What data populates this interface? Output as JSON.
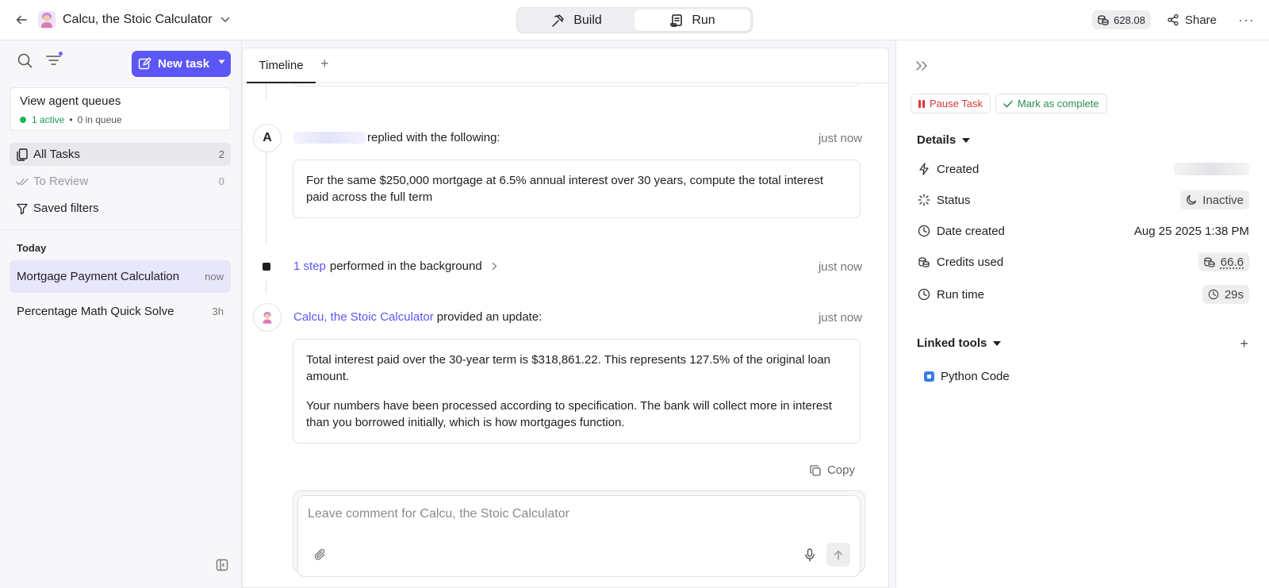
{
  "header": {
    "agent_name": "Calcu, the Stoic Calculator",
    "modes": [
      {
        "label": "Build",
        "icon": "hammer-icon",
        "active": false
      },
      {
        "label": "Run",
        "icon": "scroll-icon",
        "active": true
      }
    ],
    "credits": "628.08",
    "share_label": "Share",
    "more_label": "···"
  },
  "sidebar": {
    "new_task_label": "New task",
    "queues": {
      "title": "View agent queues",
      "active": "1 active",
      "in_queue": "0 in queue"
    },
    "nav": [
      {
        "label": "All Tasks",
        "count": "2",
        "icon": "copy-icon",
        "active": true
      },
      {
        "label": "To Review",
        "count": "0",
        "icon": "double-check-icon",
        "active": false
      },
      {
        "label": "Saved filters",
        "count": "",
        "icon": "filter-icon",
        "active": false
      }
    ],
    "section_label": "Today",
    "tasks": [
      {
        "name": "Mortgage Payment Calculation",
        "time": "now",
        "active": true
      },
      {
        "name": "Percentage Math Quick Solve",
        "time": "3h",
        "active": false
      }
    ]
  },
  "timeline": {
    "tab_label": "Timeline",
    "add_tab": "+",
    "events": {
      "reply": {
        "avatar_letter": "A",
        "action": "replied with the following:",
        "time": "just now",
        "body": "For the same $250,000 mortgage at 6.5% annual interest over 30 years, compute the total interest paid across the full term"
      },
      "step": {
        "link": "1 step",
        "text": "performed in the background",
        "time": "just now"
      },
      "update": {
        "agent": "Calcu, the Stoic Calculator",
        "action": "provided an update:",
        "time": "just now",
        "paragraphs": [
          "Total interest paid over the 30-year term is $318,861.22. This represents 127.5% of the original loan amount.",
          "Your numbers have been processed according to specification. The bank will collect more in interest than you borrowed initially, which is how mortgages function."
        ]
      }
    },
    "copy_label": "Copy",
    "composer_placeholder": "Leave comment for Calcu, the Stoic Calculator"
  },
  "details": {
    "pause_label": "Pause Task",
    "complete_label": "Mark as complete",
    "section_label": "Details",
    "rows": {
      "created": {
        "label": "Created"
      },
      "status": {
        "label": "Status",
        "value": "Inactive"
      },
      "date_created": {
        "label": "Date created",
        "value": "Aug 25 2025 1:38 PM"
      },
      "credits_used": {
        "label": "Credits used",
        "value": "66.6"
      },
      "run_time": {
        "label": "Run time",
        "value": "29s"
      }
    },
    "linked_tools_label": "Linked tools",
    "add_tool": "+",
    "tools": [
      {
        "name": "Python Code"
      }
    ]
  },
  "colors": {
    "accent": "#5b57f6",
    "active_green": "#20b25a",
    "pause_red": "#d63a3a",
    "complete_green": "#2d8a4e"
  }
}
